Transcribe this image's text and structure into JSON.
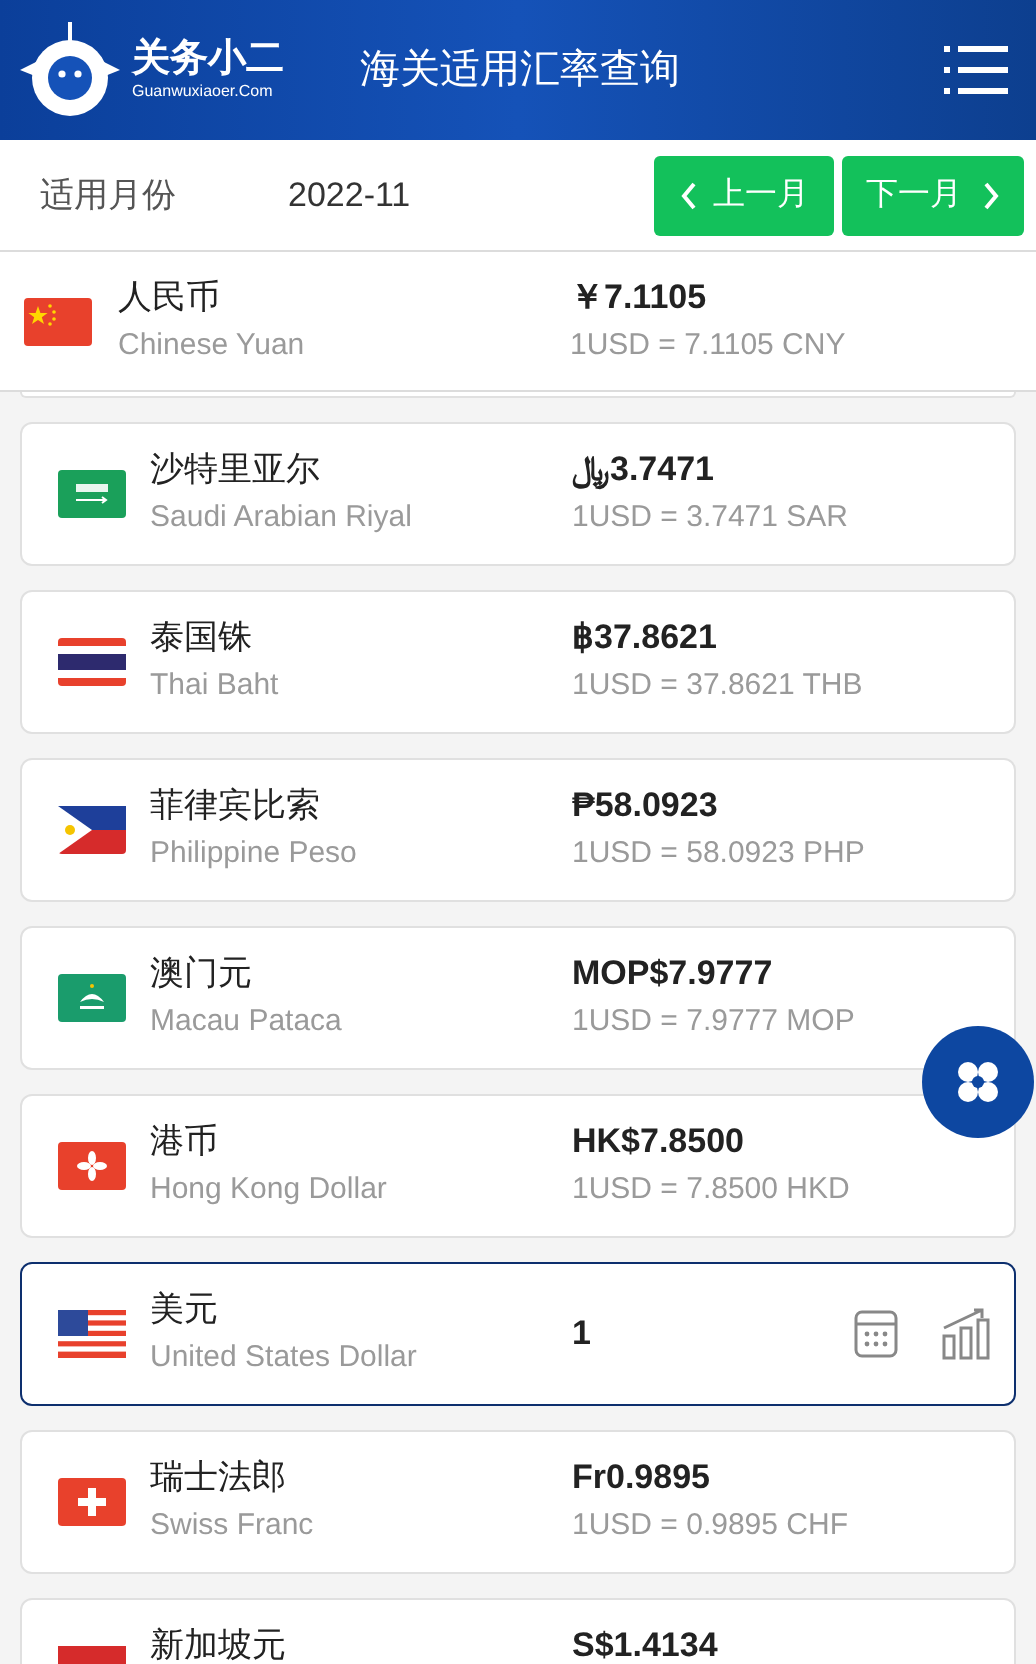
{
  "header": {
    "logo_name": "关务小二",
    "logo_domain": "Guanwuxiaoer.Com",
    "title": "海关适用汇率查询"
  },
  "toolbar": {
    "label": "适用月份",
    "month": "2022-11",
    "prev_button": "上一月",
    "next_button": "下一月"
  },
  "base_currency": {
    "kind": "china",
    "name": "人民币",
    "english": "Chinese Yuan",
    "amount": "￥7.1105",
    "rate": "1USD = 7.1105 CNY"
  },
  "currencies": [
    {
      "kind": "saudi",
      "name": "沙特里亚尔",
      "english": "Saudi Arabian Riyal",
      "amount": "﷼3.7471",
      "rate": "1USD = 3.7471 SAR",
      "selected": false
    },
    {
      "kind": "thailand",
      "name": "泰国铢",
      "english": "Thai Baht",
      "amount": "฿37.8621",
      "rate": "1USD = 37.8621 THB",
      "selected": false
    },
    {
      "kind": "philippines",
      "name": "菲律宾比索",
      "english": "Philippine Peso",
      "amount": "₱58.0923",
      "rate": "1USD = 58.0923 PHP",
      "selected": false
    },
    {
      "kind": "macau",
      "name": "澳门元",
      "english": "Macau Pataca",
      "amount": "MOP$7.9777",
      "rate": "1USD = 7.9777 MOP",
      "selected": false
    },
    {
      "kind": "hongkong",
      "name": "港币",
      "english": "Hong Kong Dollar",
      "amount": "HK$7.8500",
      "rate": "1USD = 7.8500 HKD",
      "selected": false
    },
    {
      "kind": "usa",
      "name": "美元",
      "english": "United States Dollar",
      "amount": "1",
      "selected": true
    },
    {
      "kind": "switzerland",
      "name": "瑞士法郎",
      "english": "Swiss Franc",
      "amount": "Fr0.9895",
      "rate": "1USD = 0.9895 CHF",
      "selected": false
    },
    {
      "kind": "singapore",
      "name": "新加坡元",
      "amount": "S$1.4134",
      "selected": false
    }
  ]
}
